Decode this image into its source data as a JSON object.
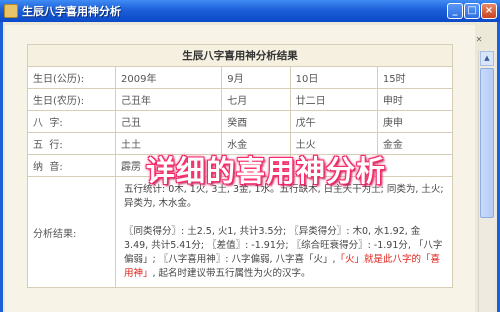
{
  "window": {
    "title": "生辰八字喜用神分析",
    "min": "_",
    "max": "□",
    "close": "×"
  },
  "report": {
    "heading": "生辰八字喜用神分析结果",
    "rows": {
      "solar": {
        "label": "生日(公历):",
        "cells": [
          "2009年",
          "9月",
          "10日",
          "15时"
        ]
      },
      "lunar": {
        "label": "生日(农历):",
        "cells": [
          "己丑年",
          "七月",
          "廿二日",
          "申时"
        ]
      },
      "bazi": {
        "label": "八  字:",
        "cells": [
          "己丑",
          "癸酉",
          "戊午",
          "庚申"
        ]
      },
      "wuxing": {
        "label": "五  行:",
        "cells": [
          "土土",
          "水金",
          "土火",
          "金金"
        ]
      },
      "nayin": {
        "label": "纳  音:",
        "cells": [
          "霹雳",
          "",
          "",
          ""
        ]
      }
    },
    "analysis": {
      "label": "分析结果:",
      "para1": "五行统计: 0木, 1火, 3土, 3金, 1水。五行缺木, 日主天干为土; 同类为, 土火; 异类为, 木水金。",
      "para2_a": "〖同类得分〗: 土2.5, 火1, 共计3.5分; 〖异类得分〗: 木0, 水1.92, 金3.49, 共计5.41分; 〖差值〗: -1.91分; 〖综合旺衰得分〗: -1.91分, 「八字偏弱」; 〖八字喜用神〗: 八字偏弱, 八字喜「火」,",
      "para2_red": "「火」就是此八字的「喜用神」",
      "para2_b": ", 起名时建议带五行属性为火的汉字。"
    }
  },
  "banner": "详细的喜用神分析",
  "colors": {
    "titlebar": "#1c5fd8",
    "banner_glow": "#e8196a",
    "highlight_red": "#e0201a"
  }
}
